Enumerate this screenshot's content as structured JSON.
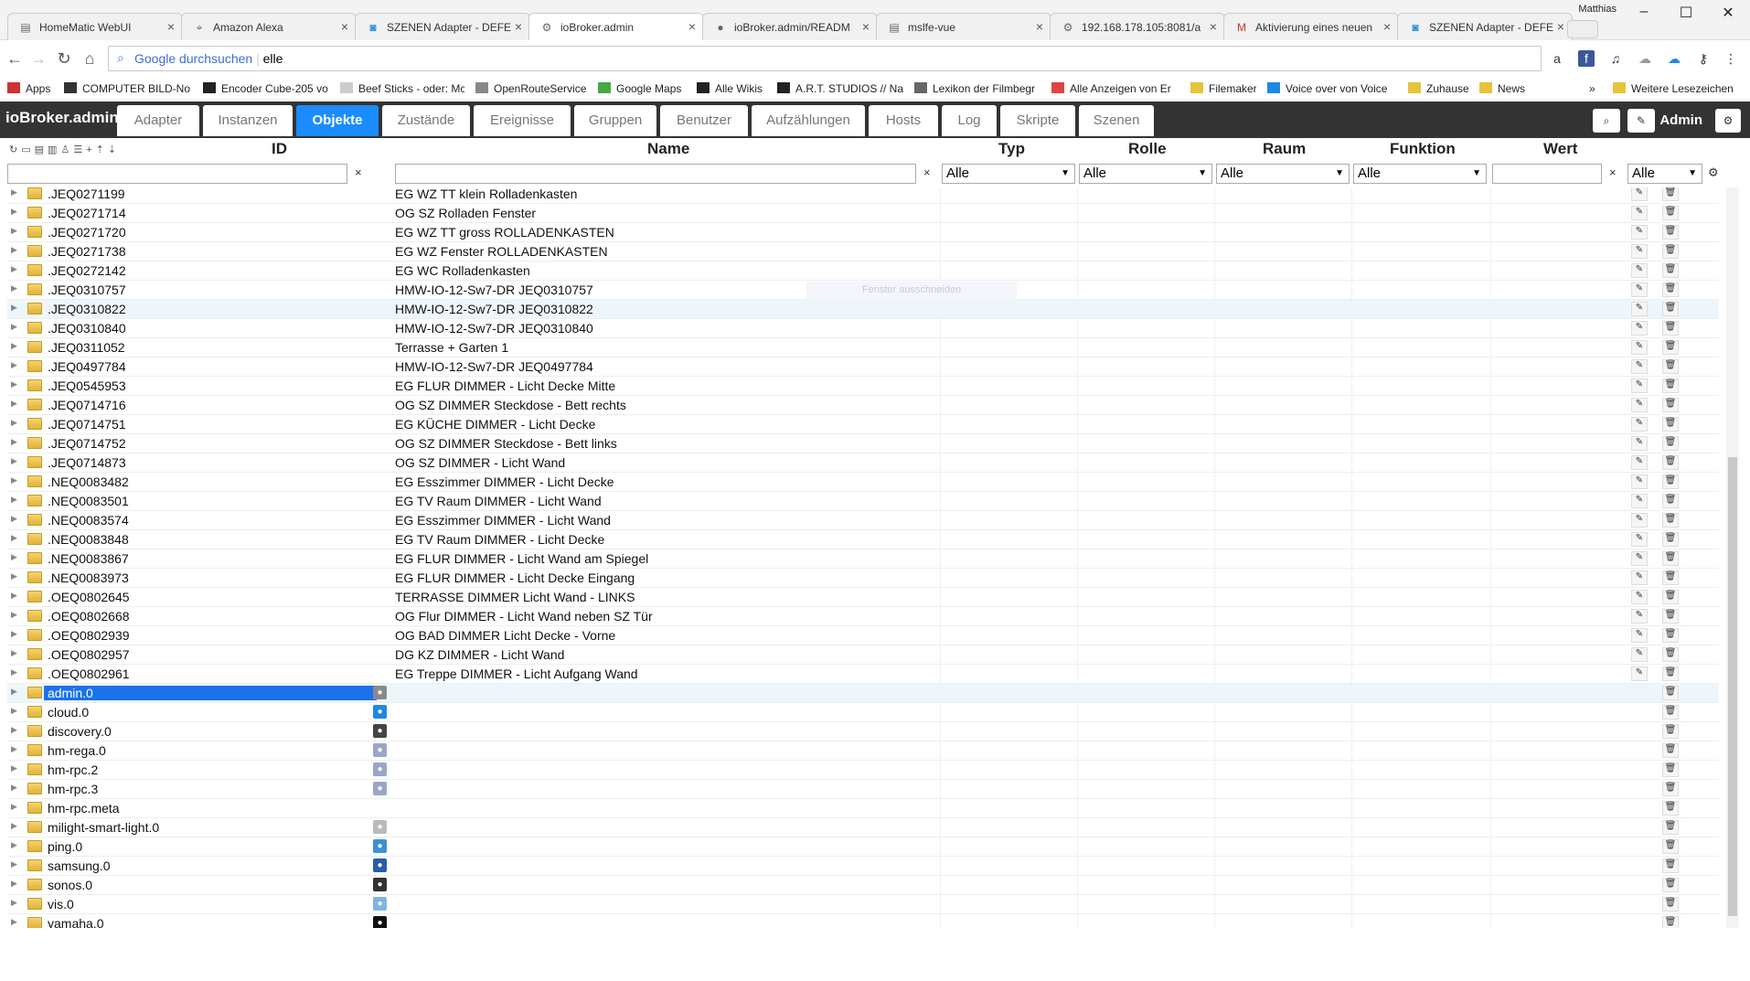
{
  "browser": {
    "tabs": [
      {
        "title": "HomeMatic WebUI",
        "icon": "doc-icon"
      },
      {
        "title": "Amazon Alexa",
        "icon": "location-icon"
      },
      {
        "title": "SZENEN Adapter - DEFE",
        "icon": "iobroker-icon"
      },
      {
        "title": "ioBroker.admin",
        "icon": "gear-icon"
      },
      {
        "title": "ioBroker.admin/READM",
        "icon": "github-icon"
      },
      {
        "title": "mslfe-vue",
        "icon": "doc-icon"
      },
      {
        "title": "192.168.178.105:8081/a",
        "icon": "gear-icon"
      },
      {
        "title": "Aktivierung eines neuen",
        "icon": "gmail-icon"
      },
      {
        "title": "SZENEN Adapter - DEFE",
        "icon": "iobroker-icon"
      }
    ],
    "profile": "Matthias",
    "omnibox_prefix": "Google durchsuchen",
    "omnibox_text": "elle",
    "bookmarks": [
      "Apps",
      "COMPUTER BILD-No",
      "Encoder Cube-205 vo",
      "Beef Sticks - oder: Mc",
      "OpenRouteService",
      "Google Maps",
      "Alle Wikis",
      "A.R.T. STUDIOS // Na",
      "Lexikon der Filmbegr",
      "Alle Anzeigen von Er",
      "Filemaker",
      "Voice over von Voice",
      "Zuhause",
      "News"
    ],
    "bookmarks_more": "»",
    "other_bookmarks": "Weitere Lesezeichen"
  },
  "app": {
    "brand": "ioBroker.admin",
    "nav_tabs": [
      "Adapter",
      "Instanzen",
      "Objekte",
      "Zustände",
      "Ereignisse",
      "Gruppen",
      "Benutzer",
      "Aufzählungen",
      "Hosts",
      "Log",
      "Skripte",
      "Szenen"
    ],
    "active_tab": "Objekte",
    "user": "Admin"
  },
  "table": {
    "headers": {
      "id": "ID",
      "name": "Name",
      "type": "Typ",
      "role": "Rolle",
      "room": "Raum",
      "function": "Funktion",
      "value": "Wert"
    },
    "filters": {
      "type": "Alle",
      "role": "Alle",
      "room": "Alle",
      "function": "Alle",
      "extra": "Alle",
      "clear": "×"
    },
    "tooltip": "Fenster ausschneiden",
    "rows": [
      {
        "id": ".JEQ0271199",
        "name": "EG WZ TT klein Rolladenkasten"
      },
      {
        "id": ".JEQ0271714",
        "name": "OG SZ Rolladen Fenster"
      },
      {
        "id": ".JEQ0271720",
        "name": "EG WZ TT gross ROLLADENKASTEN"
      },
      {
        "id": ".JEQ0271738",
        "name": "EG WZ Fenster ROLLADENKASTEN"
      },
      {
        "id": ".JEQ0272142",
        "name": "EG WC Rolladenkasten"
      },
      {
        "id": ".JEQ0310757",
        "name": "HMW-IO-12-Sw7-DR JEQ0310757"
      },
      {
        "id": ".JEQ0310822",
        "name": "HMW-IO-12-Sw7-DR JEQ0310822"
      },
      {
        "id": ".JEQ0310840",
        "name": "HMW-IO-12-Sw7-DR JEQ0310840"
      },
      {
        "id": ".JEQ0311052",
        "name": "Terrasse + Garten 1"
      },
      {
        "id": ".JEQ0497784",
        "name": "HMW-IO-12-Sw7-DR JEQ0497784"
      },
      {
        "id": ".JEQ0545953",
        "name": "EG FLUR DIMMER - Licht Decke Mitte"
      },
      {
        "id": ".JEQ0714716",
        "name": "OG SZ DIMMER Steckdose - Bett rechts"
      },
      {
        "id": ".JEQ0714751",
        "name": "EG KÜCHE DIMMER - Licht Decke"
      },
      {
        "id": ".JEQ0714752",
        "name": "OG SZ DIMMER Steckdose - Bett links"
      },
      {
        "id": ".JEQ0714873",
        "name": "OG SZ DIMMER - Licht Wand"
      },
      {
        "id": ".NEQ0083482",
        "name": "EG Esszimmer DIMMER - Licht Decke"
      },
      {
        "id": ".NEQ0083501",
        "name": "EG TV Raum DIMMER - Licht Wand"
      },
      {
        "id": ".NEQ0083574",
        "name": "EG Esszimmer DIMMER - Licht Wand"
      },
      {
        "id": ".NEQ0083848",
        "name": "EG TV Raum DIMMER - Licht Decke"
      },
      {
        "id": ".NEQ0083867",
        "name": "EG FLUR DIMMER - Licht Wand am Spiegel"
      },
      {
        "id": ".NEQ0083973",
        "name": "EG FLUR DIMMER - Licht Decke Eingang"
      },
      {
        "id": ".OEQ0802645",
        "name": "TERRASSE DIMMER Licht Wand - LINKS"
      },
      {
        "id": ".OEQ0802668",
        "name": "OG Flur DIMMER - Licht Wand neben SZ Tür"
      },
      {
        "id": ".OEQ0802939",
        "name": "OG BAD DIMMER Licht Decke - Vorne"
      },
      {
        "id": ".OEQ0802957",
        "name": "DG KZ DIMMER - Licht Wand"
      },
      {
        "id": ".OEQ0802961",
        "name": "EG Treppe DIMMER - Licht Aufgang Wand"
      }
    ],
    "adapters": [
      {
        "id": "admin.0",
        "icon": "gear-icon",
        "color": "#8a8a8a",
        "selected": true
      },
      {
        "id": "cloud.0",
        "icon": "cloud-icon",
        "color": "#1e88e5"
      },
      {
        "id": "discovery.0",
        "icon": "dog-icon",
        "color": "#444444"
      },
      {
        "id": "hm-rega.0",
        "icon": "doc-icon",
        "color": "#9aa6c8"
      },
      {
        "id": "hm-rpc.2",
        "icon": "doc-icon",
        "color": "#9aa6c8"
      },
      {
        "id": "hm-rpc.3",
        "icon": "doc-icon",
        "color": "#9aa6c8"
      },
      {
        "id": "hm-rpc.meta",
        "icon": "",
        "color": ""
      },
      {
        "id": "milight-smart-light.0",
        "icon": "bulb-icon",
        "color": "#bbbbbb"
      },
      {
        "id": "ping.0",
        "icon": "ping-icon",
        "color": "#3d8fd6"
      },
      {
        "id": "samsung.0",
        "icon": "tv-icon",
        "color": "#2a5ca8"
      },
      {
        "id": "sonos.0",
        "icon": "speaker-icon",
        "color": "#333333"
      },
      {
        "id": "vis.0",
        "icon": "vis-icon",
        "color": "#7fb4e6"
      },
      {
        "id": "yamaha.0",
        "icon": "yamaha-icon",
        "color": "#111111"
      }
    ]
  }
}
